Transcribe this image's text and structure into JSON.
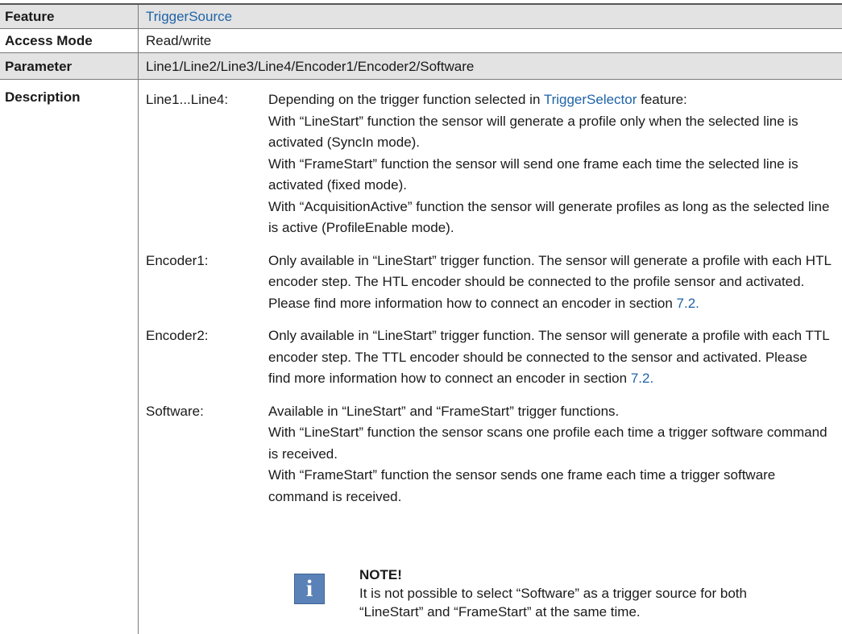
{
  "table": {
    "rows": [
      {
        "label": "Feature",
        "value": "TriggerSource"
      },
      {
        "label": "Access Mode",
        "value": "Read/write"
      },
      {
        "label": "Parameter",
        "value": "Line1/Line2/Line3/Line4/Encoder1/Encoder2/Software"
      },
      {
        "label": "Description"
      }
    ]
  },
  "description": {
    "entries": [
      {
        "term": "Line1...Line4:",
        "def_pre": "Depending on the trigger function selected in ",
        "def_link": "TriggerSelector",
        "def_post": " feature:",
        "def_lines": [
          "With “LineStart” function the sensor will generate a profile only when the selected line is activated (SyncIn mode).",
          "With “FrameStart” function the sensor will send one frame each time the selected line is activated (fixed mode).",
          "With “AcquisitionActive” function the sensor will generate profiles as long as the selected line is active (ProfileEnable mode)."
        ]
      },
      {
        "term": "Encoder1:",
        "text": "Only available in “LineStart” trigger function. The sensor will generate a profile with each HTL encoder step. The HTL encoder should be connec­ted to the profile sensor and activated. Please find more information how to connect an encoder in section ",
        "link": "7.2."
      },
      {
        "term": "Encoder2:",
        "text": "Only available in “LineStart” trigger function. The sensor will generate a profile with each TTL encoder step. The TTL encoder should be connected to the sensor and activated. Please find more information how to connect an encoder in section ",
        "link": "7.2."
      },
      {
        "term": "Software:",
        "def_lines": [
          "Available in “LineStart” and “FrameStart” trigger functions.",
          "With “LineStart” function the sensor scans one profile each time a trigger software command is received.",
          "With “FrameStart” function the sensor sends one frame each time a trigger software command is received."
        ]
      }
    ],
    "note": {
      "icon": "info-icon",
      "icon_glyph": "i",
      "title": "NOTE!",
      "text": "It is not possible to select “Software” as a trigger source for both “LineStart” and “FrameStart” at the same time."
    }
  }
}
